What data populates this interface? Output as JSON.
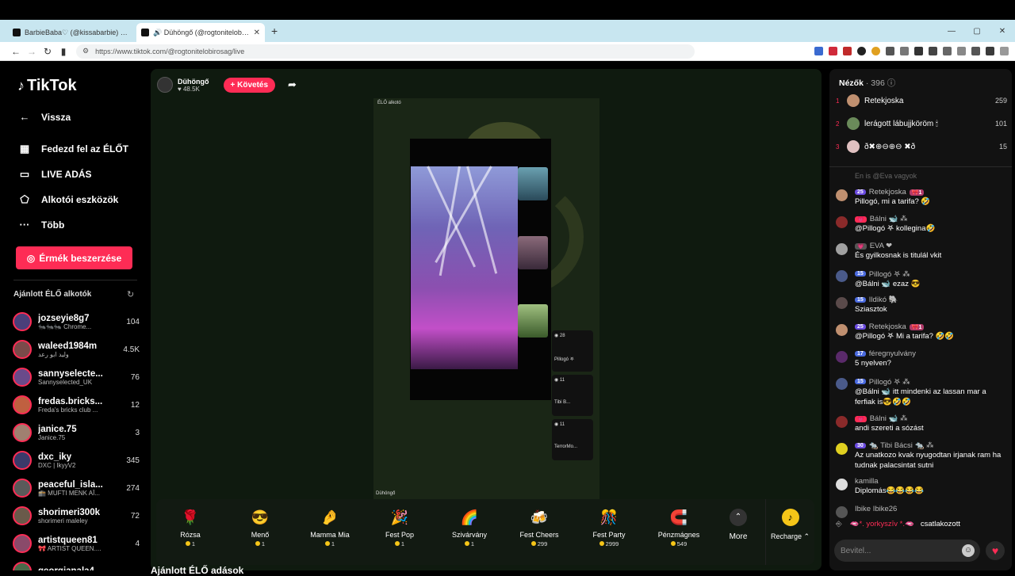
{
  "browser": {
    "tabs": [
      {
        "title": "BarbieBaba♡ (@kissabarbie) ÉLŐ ad",
        "active": false
      },
      {
        "title": "🔊 Dühöngő (@rogtonitelobirosag",
        "active": true
      }
    ],
    "new_tab": "+",
    "url": "https://www.tiktok.com/@rogtonitelobirosag/live",
    "win": {
      "min": "—",
      "max": "▢",
      "close": "✕"
    }
  },
  "sidebar": {
    "logo": "TikTok",
    "back": "Vissza",
    "nav": [
      "Fedezd fel az ÉLŐT",
      "LIVE ADÁS",
      "Alkotói eszközök",
      "Több"
    ],
    "coin_button": "Érmék beszerzése",
    "recommended_title": "Ajánlott ÉLŐ alkotók",
    "creators": [
      {
        "name": "jozseyie8g7",
        "sub": "🐜🐜🐜 Chrome...",
        "count": "104",
        "color": "#4a3f7a"
      },
      {
        "name": "waleed1984m",
        "sub": "وليد ابو رعد",
        "count": "4.5K",
        "color": "#7a4a4a"
      },
      {
        "name": "sannyselecte...",
        "sub": "Sannyselected_UK",
        "count": "76",
        "color": "#6a4a8a"
      },
      {
        "name": "fredas.bricks...",
        "sub": "Freda's bricks club ...",
        "count": "12",
        "color": "#c06040"
      },
      {
        "name": "janice.75",
        "sub": "Janice.75",
        "count": "3",
        "color": "#a08070"
      },
      {
        "name": "dxc_iky",
        "sub": "DXC | IkyyV2",
        "count": "345",
        "color": "#3a3a6a"
      },
      {
        "name": "peaceful_isla...",
        "sub": "🕋 MUFTI MENK AĪ...",
        "count": "274",
        "color": "#5a5a5a"
      },
      {
        "name": "shorimeri300k",
        "sub": "shorimeri maleley",
        "count": "72",
        "color": "#6a5a4a"
      },
      {
        "name": "artistqueen81",
        "sub": "🎀 ARTIST QUEEN....",
        "count": "4",
        "color": "#8a4a6a"
      },
      {
        "name": "georgianala4",
        "sub": "",
        "count": "",
        "color": "#4a6a4a"
      }
    ]
  },
  "stream": {
    "host_name": "Dühöngő",
    "likes": "48.5K",
    "follow": "+ Követés",
    "video_tag": "ÉLŐ alkotó",
    "host_label": "Dühöngő",
    "guests": [
      {
        "score": "28",
        "name": "Pillogó 𖤐"
      },
      {
        "score": "11",
        "name": "Tibi B..."
      },
      {
        "score": "11",
        "name": "TerrorMo..."
      }
    ]
  },
  "gifts": [
    {
      "name": "Rózsa",
      "price": "1",
      "icon": "🌹"
    },
    {
      "name": "Menő",
      "price": "1",
      "icon": "😎"
    },
    {
      "name": "Mamma Mia",
      "price": "1",
      "icon": "🤌"
    },
    {
      "name": "Fest Pop",
      "price": "1",
      "icon": "🎉"
    },
    {
      "name": "Szivárvány",
      "price": "1",
      "icon": "🌈"
    },
    {
      "name": "Fest Cheers",
      "price": "299",
      "icon": "🍻"
    },
    {
      "name": "Fest Party",
      "price": "2999",
      "icon": "🎊"
    },
    {
      "name": "Pénzmágnes",
      "price": "549",
      "icon": "🧲"
    }
  ],
  "gift_more": "More",
  "recharge": "Recharge ⌃",
  "bottom_title": "Ajánlott ÉLŐ adások",
  "chat": {
    "viewers_title": "Nézők",
    "viewers_count": "· 396",
    "top_viewers": [
      {
        "rank": "1",
        "name": "Retekjoska",
        "score": "259",
        "color": "#c09070"
      },
      {
        "rank": "2",
        "name": "lerágott lábujjköröm 🕯",
        "score": "101",
        "color": "#6a8a5a"
      },
      {
        "rank": "3",
        "name": "ð✖︎⊕⊖⊕⊖ ✖︎ð",
        "score": "15",
        "color": "#e0c0c0"
      }
    ],
    "partial": "En is @Eva vagyok",
    "messages": [
      {
        "badge": "25",
        "badge_color": "#6a4adf",
        "user": "Retekjoska",
        "extra": "🎀1",
        "text": "Pillogó, mi a tarifa? 🤣",
        "av": "#c09070"
      },
      {
        "badge": "💗",
        "badge_color": "#fe2c55",
        "user": "Bálni 🐋 ⁂",
        "extra": "",
        "text": "@Pillogó 𖤐 kollegina🤣",
        "av": "#8a2a2a"
      },
      {
        "badge": "💗",
        "badge_color": "#555",
        "user": "EVA ❤",
        "extra": "",
        "text": "És gyilkosnak is titulál vkit",
        "av": "#a0a0a0"
      },
      {
        "badge": "15",
        "badge_color": "#4a6adf",
        "user": "Pillogó 𖤐 ⁂",
        "extra": "",
        "text": "@Bálni 🐋 ezaz 😎",
        "av": "#4a5a8a"
      },
      {
        "badge": "15",
        "badge_color": "#4a6adf",
        "user": "Ildikó 🐘",
        "extra": "",
        "text": "Sziasztok",
        "av": "#5a4a4a"
      },
      {
        "badge": "25",
        "badge_color": "#6a4adf",
        "user": "Retekjoska",
        "extra": "🎀1",
        "text": "@Pillogó 𖤐 Mi a tarifa? 🤣🤣",
        "av": "#c09070"
      },
      {
        "badge": "17",
        "badge_color": "#4a6adf",
        "user": "féregnyulvány",
        "extra": "",
        "text": "5 nyelven?",
        "av": "#5a2a6a"
      },
      {
        "badge": "15",
        "badge_color": "#4a6adf",
        "user": "Pillogó 𖤐 ⁂",
        "extra": "",
        "text": "@Bálni 🐋 itt mindenki az lassan mar a ferfiak is😎🤣🤣",
        "av": "#4a5a8a"
      },
      {
        "badge": "💗",
        "badge_color": "#fe2c55",
        "user": "Bálni 🐋 ⁂",
        "extra": "",
        "text": "andi szereti a sózást",
        "av": "#8a2a2a"
      },
      {
        "badge": "30",
        "badge_color": "#6a4adf",
        "user": "🐀 Tibi Bácsi 🐀 ⁂",
        "extra": "",
        "text": "Az unatkozo kvak nyugodtan irjanak ram ha tudnak palacsintat sutni",
        "av": "#e0d020"
      },
      {
        "badge": "",
        "badge_color": "",
        "user": "kamilla",
        "extra": "",
        "text": "Diplomás😂😂😂😂",
        "av": "#dddddd"
      },
      {
        "badge": "",
        "badge_color": "",
        "user": "Ibike Ibike26",
        "extra": "",
        "text": "",
        "av": "#555"
      }
    ],
    "join_user": "🫦*. yorkyszīv *.🫦",
    "join_text": "csatlakozott",
    "input_placeholder": "Bevitel..."
  }
}
